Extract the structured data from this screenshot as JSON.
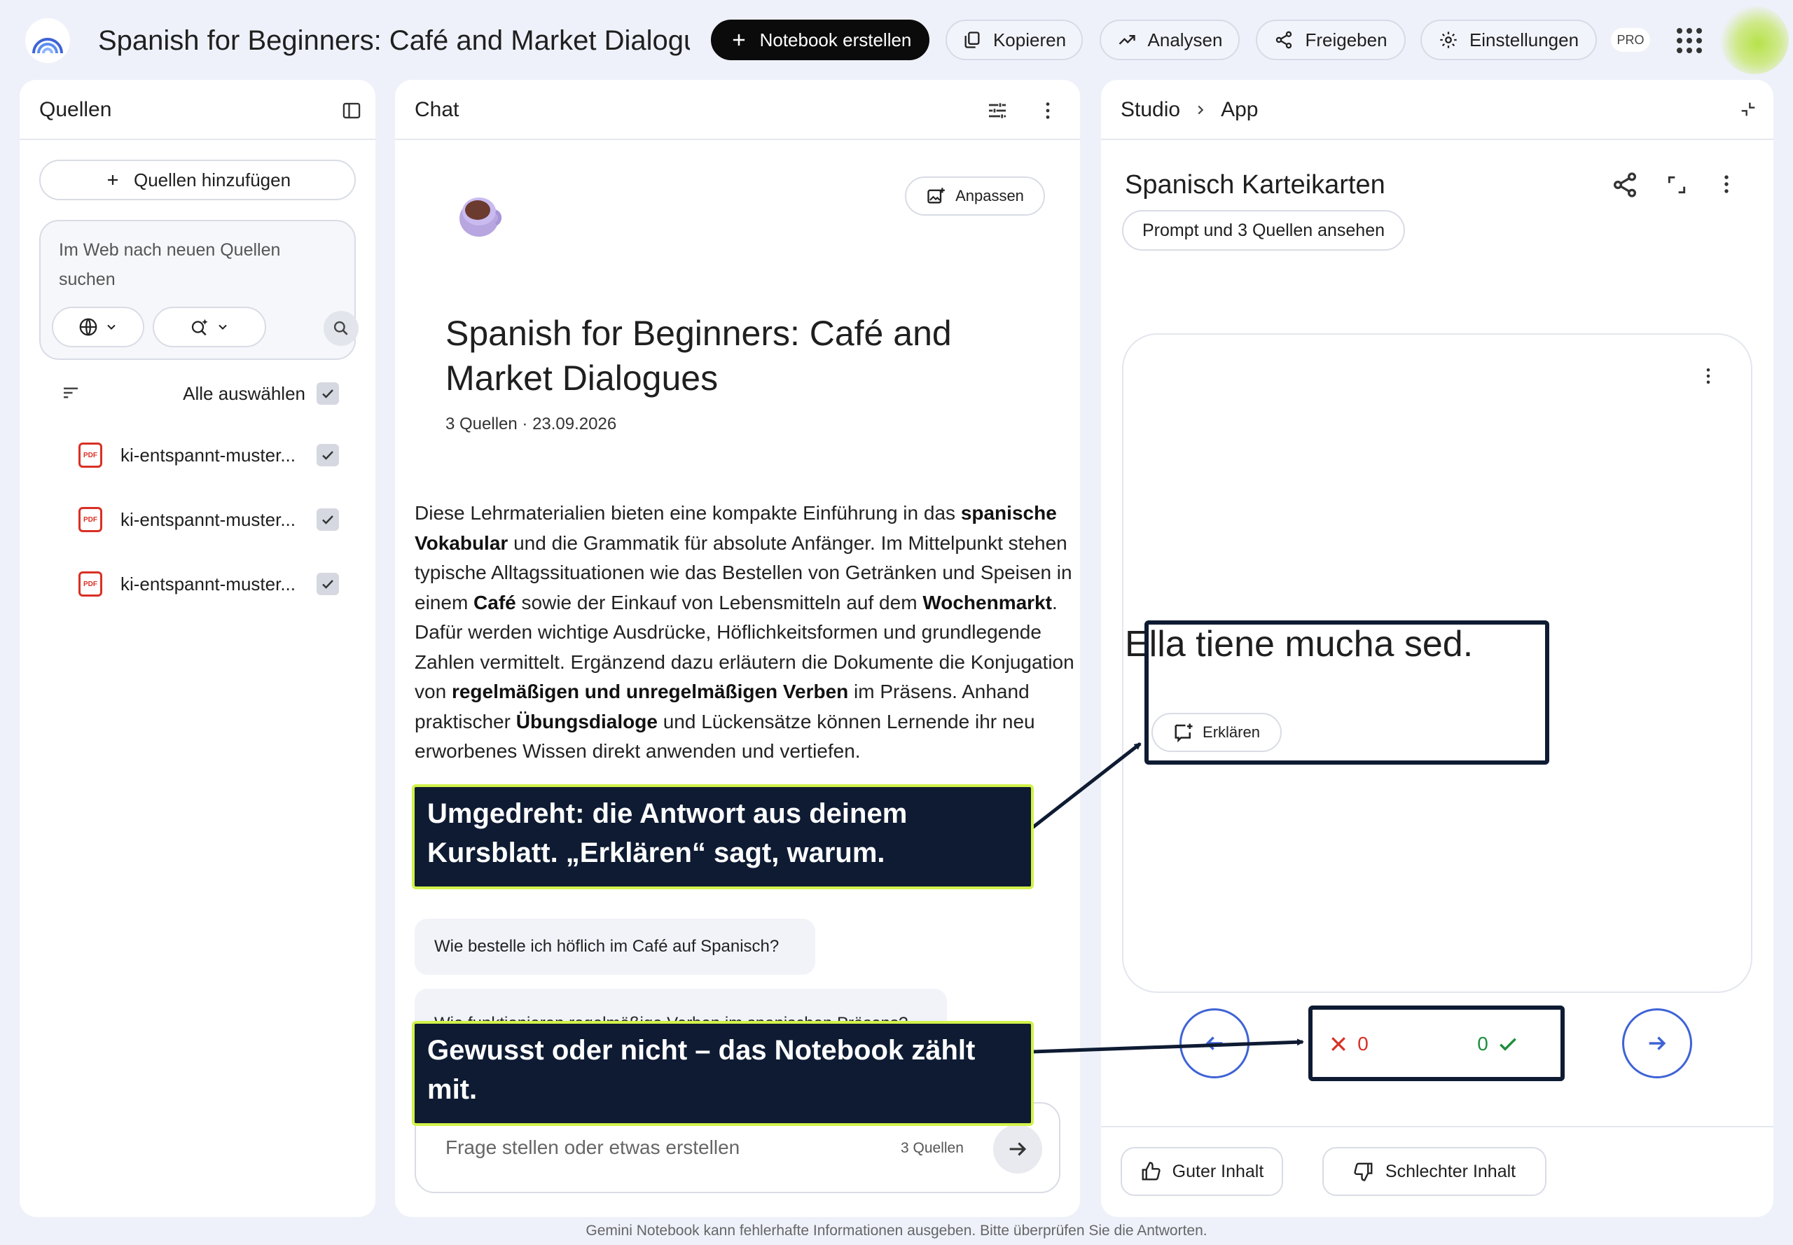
{
  "topbar": {
    "title": "Spanish for Beginners: Café and Market Dialogues",
    "buttons": {
      "create_notebook": "Notebook erstellen",
      "copy": "Kopieren",
      "analytics": "Analysen",
      "share": "Freigeben",
      "settings": "Einstellungen"
    },
    "pro_badge": "PRO"
  },
  "sources": {
    "title": "Quellen",
    "add_button": "Quellen hinzufügen",
    "search_placeholder": "Im Web nach neuen Quellen suchen",
    "select_all": "Alle auswählen",
    "items": [
      {
        "name": "ki-entspannt-muster..."
      },
      {
        "name": "ki-entspannt-muster..."
      },
      {
        "name": "ki-entspannt-muster..."
      }
    ]
  },
  "chat": {
    "title": "Chat",
    "customize_button": "Anpassen",
    "notebook_title": "Spanish for Beginners: Café and Market Dialogues",
    "meta": "3 Quellen · 23.09.2026",
    "summary": [
      {
        "t": "Diese Lehrmaterialien bieten eine kompakte Einführung in das ",
        "b": false
      },
      {
        "t": "spanische Vokabular",
        "b": true
      },
      {
        "t": " und die Grammatik für absolute Anfänger. Im Mittelpunkt stehen typische Alltagssituationen wie das Bestellen von Getränken und Speisen in einem ",
        "b": false
      },
      {
        "t": "Café",
        "b": true
      },
      {
        "t": " sowie der Einkauf von Lebensmitteln auf dem ",
        "b": false
      },
      {
        "t": "Wochenmarkt",
        "b": true
      },
      {
        "t": ". Dafür werden wichtige Ausdrücke, Höflichkeitsformen und grundlegende Zahlen vermittelt. Ergänzend dazu erläutern die Dokumente die Konjugation von ",
        "b": false
      },
      {
        "t": "regelmäßigen und unregelmäßigen Verben",
        "b": true
      },
      {
        "t": " im Präsens. Anhand praktischer ",
        "b": false
      },
      {
        "t": "Übungsdialoge",
        "b": true
      },
      {
        "t": " und Lückensätze können Lernende ihr neu erworbenes Wissen direkt anwenden und vertiefen.",
        "b": false
      }
    ],
    "suggestions": [
      "Wie bestelle ich höflich im Café auf Spanisch?",
      "Wie funktionieren regelmäßige Verben im spanischen Präsens?"
    ],
    "input_placeholder": "Frage stellen oder etwas erstellen",
    "input_source_count": "3 Quellen"
  },
  "studio": {
    "breadcrumb_root": "Studio",
    "breadcrumb_current": "App",
    "flashcards_title": "Spanisch Karteikarten",
    "prompt_button": "Prompt und 3 Quellen ansehen",
    "card_text": "Ella tiene mucha sed.",
    "explain_button": "Erklären",
    "wrong_count": "0",
    "right_count": "0",
    "good_button": "Guter Inhalt",
    "bad_button": "Schlechter Inhalt"
  },
  "annotations": {
    "callout_top": "Umgedreht: die Antwort aus deinem Kursblatt. „Erklären“ sagt, warum.",
    "callout_bottom": "Gewusst oder nicht – das Notebook zählt mit."
  },
  "footer": "Gemini Notebook kann fehlerhafte Informationen ausgeben. Bitte überprüfen Sie die Antworten.",
  "colors": {
    "background": "#eef1fa",
    "accent_blue": "#3f63d6",
    "wrong_red": "#d93025",
    "right_green": "#1e8e3e",
    "callout_bg": "#0e1b33",
    "callout_border": "#d2f24a"
  }
}
